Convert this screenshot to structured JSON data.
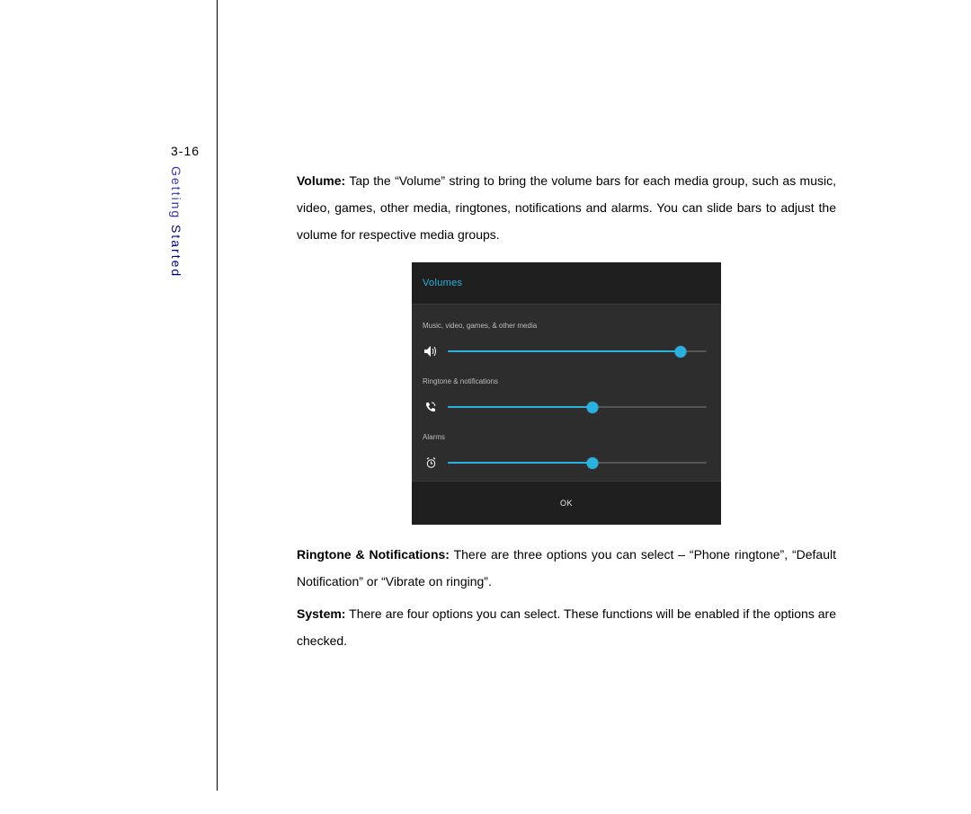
{
  "pageNumber": "3-16",
  "sectionTitle": {
    "word1": "Getting",
    "word2": "Started"
  },
  "paragraphs": {
    "volume_label": "Volume:",
    "volume_body": " Tap the “Volume” string to bring the volume bars for each media group, such as music, video, games, other media, ringtones, notifications and alarms. You can slide bars to adjust the volume for respective media groups.",
    "ringtone_label": "Ringtone & Notifications:",
    "ringtone_body": " There are three options you can select – “Phone ringtone”, “Default Notification” or “Vibrate on ringing”.",
    "system_label": "System:",
    "system_body": " There are four options you can select. These functions will be enabled if the options are checked."
  },
  "volumeDialog": {
    "title": "Volumes",
    "ok": "OK",
    "rows": [
      {
        "label": "Music, video, games, & other media",
        "icon": "speaker-icon",
        "percent": 90
      },
      {
        "label": "Ringtone & notifications",
        "icon": "phone-icon",
        "percent": 56
      },
      {
        "label": "Alarms",
        "icon": "alarm-icon",
        "percent": 56
      }
    ]
  },
  "colors": {
    "accent": "#29b2e0",
    "dialogBg": "#2d2d2d"
  }
}
